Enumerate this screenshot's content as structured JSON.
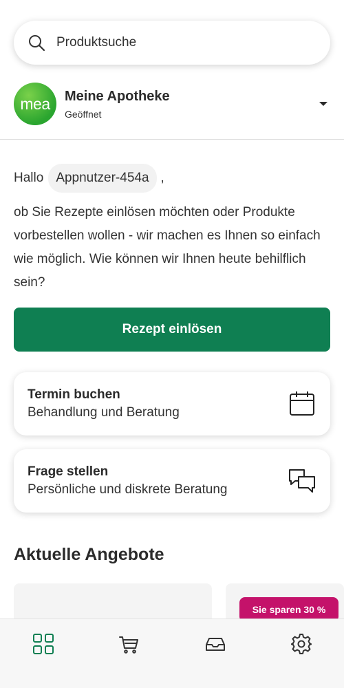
{
  "search": {
    "placeholder": "Produktsuche",
    "icon": "search-icon"
  },
  "pharmacy": {
    "logo_text": "mea",
    "name": "Meine Apotheke",
    "status": "Geöffnet"
  },
  "greeting": {
    "hello": "Hallo",
    "username": "Appnutzer-454a",
    "suffix": ","
  },
  "intro": "ob Sie Rezepte einlösen möchten oder Produkte vorbestellen wollen - wir machen es Ihnen so einfach wie möglich. Wie können wir Ihnen heute behilflich sein?",
  "actions": {
    "redeem_label": "Rezept einlösen"
  },
  "cards": [
    {
      "title": "Termin buchen",
      "subtitle": "Behandlung und Beratung",
      "icon": "calendar-icon"
    },
    {
      "title": "Frage stellen",
      "subtitle": "Persönliche und diskrete Beratung",
      "icon": "chat-icon"
    }
  ],
  "offers": {
    "title": "Aktuelle Angebote",
    "badge": "Sie sparen 30 %"
  },
  "tabs": [
    {
      "icon": "grid-icon",
      "active": true
    },
    {
      "icon": "cart-icon",
      "active": false
    },
    {
      "icon": "inbox-icon",
      "active": false
    },
    {
      "icon": "gear-icon",
      "active": false
    }
  ],
  "colors": {
    "primary": "#0f7f52",
    "badge": "#c4126a",
    "logo_green": "#3aaa35"
  }
}
